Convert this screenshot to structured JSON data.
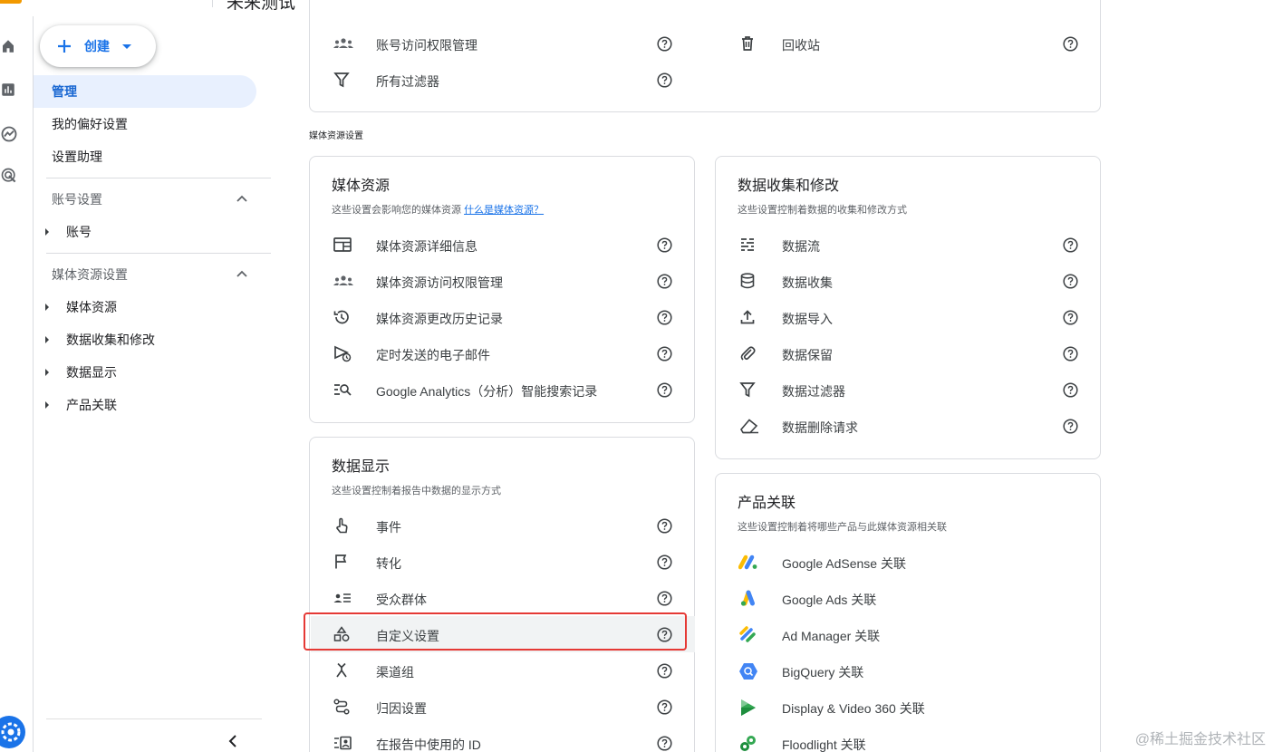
{
  "header": {
    "title": "未来测试"
  },
  "nav": {
    "create_label": "创建",
    "admin_label": "管理",
    "preferences_label": "我的偏好设置",
    "setup_assistant_label": "设置助理",
    "account_settings_label": "账号设置",
    "account_items": [
      "账号"
    ],
    "property_settings_label": "媒体资源设置",
    "property_items": [
      "媒体资源",
      "数据收集和修改",
      "数据显示",
      "产品关联"
    ]
  },
  "account_card": {
    "left_rows": [
      {
        "label": "账号访问权限管理",
        "icon": "people-icon"
      },
      {
        "label": "所有过滤器",
        "icon": "filter-icon"
      }
    ],
    "right_rows": [
      {
        "label": "回收站",
        "icon": "trash-icon"
      }
    ]
  },
  "section_label": "媒体资源设置",
  "property_card": {
    "title": "媒体资源",
    "desc": "这些设置会影响您的媒体资源",
    "desc_link": "什么是媒体资源？",
    "rows": [
      {
        "label": "媒体资源详细信息",
        "icon": "details-icon"
      },
      {
        "label": "媒体资源访问权限管理",
        "icon": "people-icon"
      },
      {
        "label": "媒体资源更改历史记录",
        "icon": "history-icon"
      },
      {
        "label": "定时发送的电子邮件",
        "icon": "scheduled-send-icon"
      },
      {
        "label": "Google Analytics（分析）智能搜索记录",
        "icon": "search-history-icon"
      }
    ]
  },
  "data_display_card": {
    "title": "数据显示",
    "desc": "这些设置控制着报告中数据的显示方式",
    "rows": [
      {
        "label": "事件",
        "icon": "touch-icon"
      },
      {
        "label": "转化",
        "icon": "flag-icon"
      },
      {
        "label": "受众群体",
        "icon": "audience-icon"
      },
      {
        "label": "自定义设置",
        "icon": "shapes-icon"
      },
      {
        "label": "渠道组",
        "icon": "merge-icon"
      },
      {
        "label": "归因设置",
        "icon": "route-icon"
      },
      {
        "label": "在报告中使用的 ID",
        "icon": "id-icon"
      }
    ]
  },
  "data_collection_card": {
    "title": "数据收集和修改",
    "desc": "这些设置控制着数据的收集和修改方式",
    "rows": [
      {
        "label": "数据流",
        "icon": "stream-icon"
      },
      {
        "label": "数据收集",
        "icon": "database-icon"
      },
      {
        "label": "数据导入",
        "icon": "upload-icon"
      },
      {
        "label": "数据保留",
        "icon": "attachment-icon"
      },
      {
        "label": "数据过滤器",
        "icon": "filter-icon"
      },
      {
        "label": "数据删除请求",
        "icon": "eraser-icon"
      }
    ]
  },
  "product_links_card": {
    "title": "产品关联",
    "desc": "这些设置控制着将哪些产品与此媒体资源相关联",
    "rows": [
      {
        "label": "Google AdSense 关联",
        "icon": "adsense-logo-icon"
      },
      {
        "label": "Google Ads 关联",
        "icon": "google-ads-logo-icon"
      },
      {
        "label": "Ad Manager 关联",
        "icon": "ad-manager-logo-icon"
      },
      {
        "label": "BigQuery 关联",
        "icon": "bigquery-logo-icon"
      },
      {
        "label": "Display & Video 360 关联",
        "icon": "dv360-logo-icon"
      },
      {
        "label": "Floodlight 关联",
        "icon": "floodlight-logo-icon"
      }
    ]
  },
  "watermark": "@稀土掘金技术社区",
  "colors": {
    "accent": "#1a73e8",
    "highlight_border": "#e53935",
    "active_nav_bg": "#e8f0fe"
  }
}
